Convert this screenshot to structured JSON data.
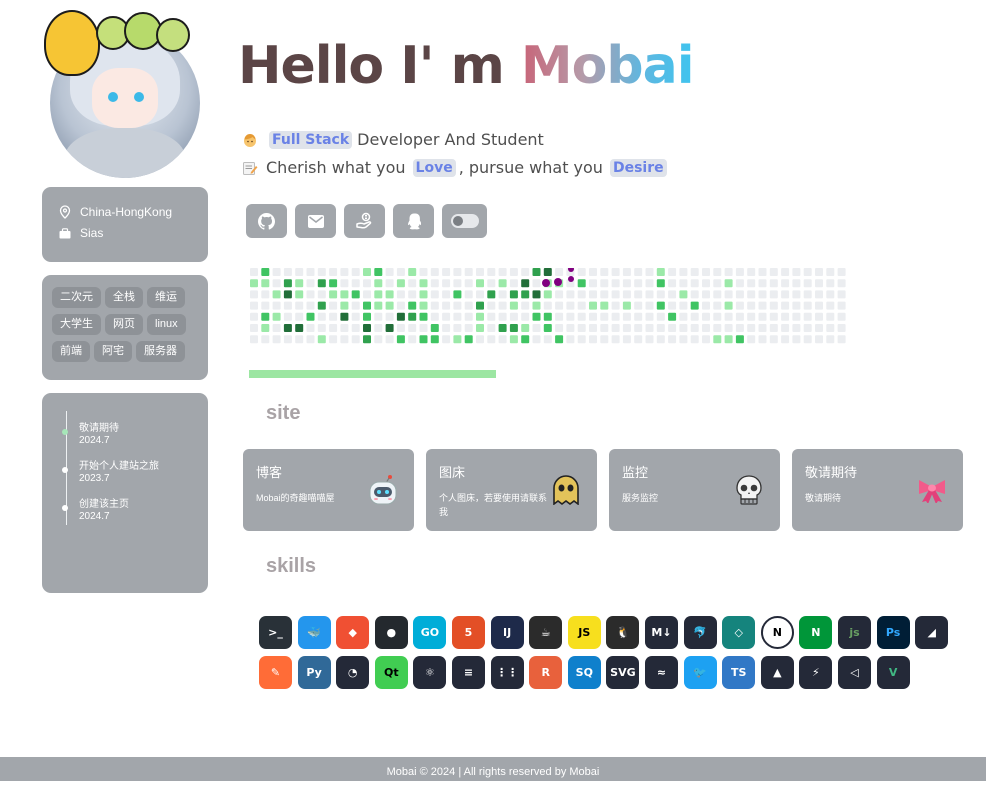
{
  "hero": {
    "hello": "Hello I' m ",
    "name": "Mobai",
    "line1_tag": "Full Stack",
    "line1_rest": "Developer And Student",
    "line2_a": "Cherish what you",
    "line2_tag1": "Love",
    "line2_b": ", pursue what you",
    "line2_tag2": "Desire"
  },
  "profile": {
    "location": "China-HongKong",
    "school": "Sias"
  },
  "tags": [
    "二次元",
    "全栈",
    "维运",
    "大学生",
    "网页",
    "linux",
    "前端",
    "阿宅",
    "服务器"
  ],
  "timeline": [
    {
      "title": "敬请期待",
      "date": "2024.7"
    },
    {
      "title": "开始个人建站之旅",
      "date": "2023.7"
    },
    {
      "title": "创建该主页",
      "date": "2024.7"
    }
  ],
  "social": [
    "github-icon",
    "mail-icon",
    "hand-icon",
    "qq-icon",
    "theme-toggle"
  ],
  "sections": {
    "site": "site",
    "skills": "skills"
  },
  "sites": [
    {
      "title": "博客",
      "desc": "Mobai的奇趣喵喵屋",
      "icon": "robot-icon"
    },
    {
      "title": "图床",
      "desc": "个人图床，若要使用请联系我",
      "icon": "ghost-icon"
    },
    {
      "title": "监控",
      "desc": "服务监控",
      "icon": "skull-icon"
    },
    {
      "title": "敬请期待",
      "desc": "敬请期待",
      "icon": "ribbon-icon"
    }
  ],
  "skills": [
    "bash",
    "docker",
    "git",
    "github",
    "go",
    "html5",
    "intellij",
    "java",
    "javascript",
    "linux",
    "markdown",
    "mysql",
    "netlify",
    "nextjs",
    "nginx",
    "nodejs",
    "photoshop",
    "pocketbase",
    "postman",
    "python",
    "quasar",
    "qt",
    "react",
    "redis",
    "raycast",
    "rust",
    "sqlite",
    "svg",
    "tailwind",
    "twitter",
    "typescript",
    "vercel",
    "vite",
    "vscode",
    "vue"
  ],
  "colors": {
    "card": "#a2a6ab",
    "accent": "#6a82e6",
    "progress": "#9ce6a2",
    "heat": [
      "#ebedf0",
      "#9be9a8",
      "#40c463",
      "#30a14e",
      "#216e39"
    ],
    "purple": "#800080"
  },
  "footer": "Mobai © 2024 | All rights reserved by Mobai"
}
